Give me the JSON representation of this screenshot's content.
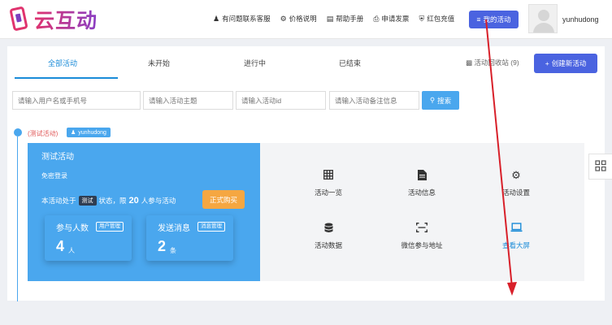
{
  "brand": {
    "name": "云互动"
  },
  "top_nav": [
    {
      "label": "有问题联系客服",
      "icon": "user-plus-icon"
    },
    {
      "label": "价格说明",
      "icon": "gear-icon"
    },
    {
      "label": "帮助手册",
      "icon": "book-icon"
    },
    {
      "label": "申请发票",
      "icon": "printer-icon"
    },
    {
      "label": "红包充值",
      "icon": "shield-icon"
    }
  ],
  "my_activity_button": "我的活动",
  "user": {
    "name": "yunhudong"
  },
  "tabs": [
    "全部活动",
    "未开始",
    "进行中",
    "已结束"
  ],
  "recycle": "活动回收站 (9)",
  "create_button": "创建新活动",
  "filters": {
    "user_placeholder": "请输入用户名或手机号",
    "topic_placeholder": "请输入活动主题",
    "id_placeholder": "请输入活动id",
    "note_placeholder": "请输入活动备注信息",
    "search_label": "搜索"
  },
  "timeline": {
    "label": "(测试活动)",
    "user_tag": "yunhudong"
  },
  "activity": {
    "title": "测试活动",
    "login": "免密登录",
    "status_prefix": "本活动处于",
    "status_badge": "测试",
    "status_mid": "状态，限",
    "limit": "20",
    "status_suffix": "人参与活动",
    "buy_button": "正式购买",
    "participants_label": "参与人数",
    "participants_manage": "用户管理",
    "participants_count": "4",
    "participants_unit": "人",
    "messages_label": "发送消息",
    "messages_manage": "消息管理",
    "messages_count": "2",
    "messages_unit": "条"
  },
  "actions": [
    {
      "label": "活动一览",
      "icon": "grid-icon"
    },
    {
      "label": "活动信息",
      "icon": "document-icon"
    },
    {
      "label": "活动设置",
      "icon": "gear-icon"
    },
    {
      "label": "活动数据",
      "icon": "database-icon"
    },
    {
      "label": "微信参与地址",
      "icon": "qrcode-scan-icon"
    },
    {
      "label": "查看大屏",
      "icon": "laptop-icon"
    }
  ],
  "colors": {
    "primary": "#4a63e0",
    "card_blue": "#4aa7ee",
    "orange": "#f5a742",
    "annotation_red": "#d8202a"
  }
}
